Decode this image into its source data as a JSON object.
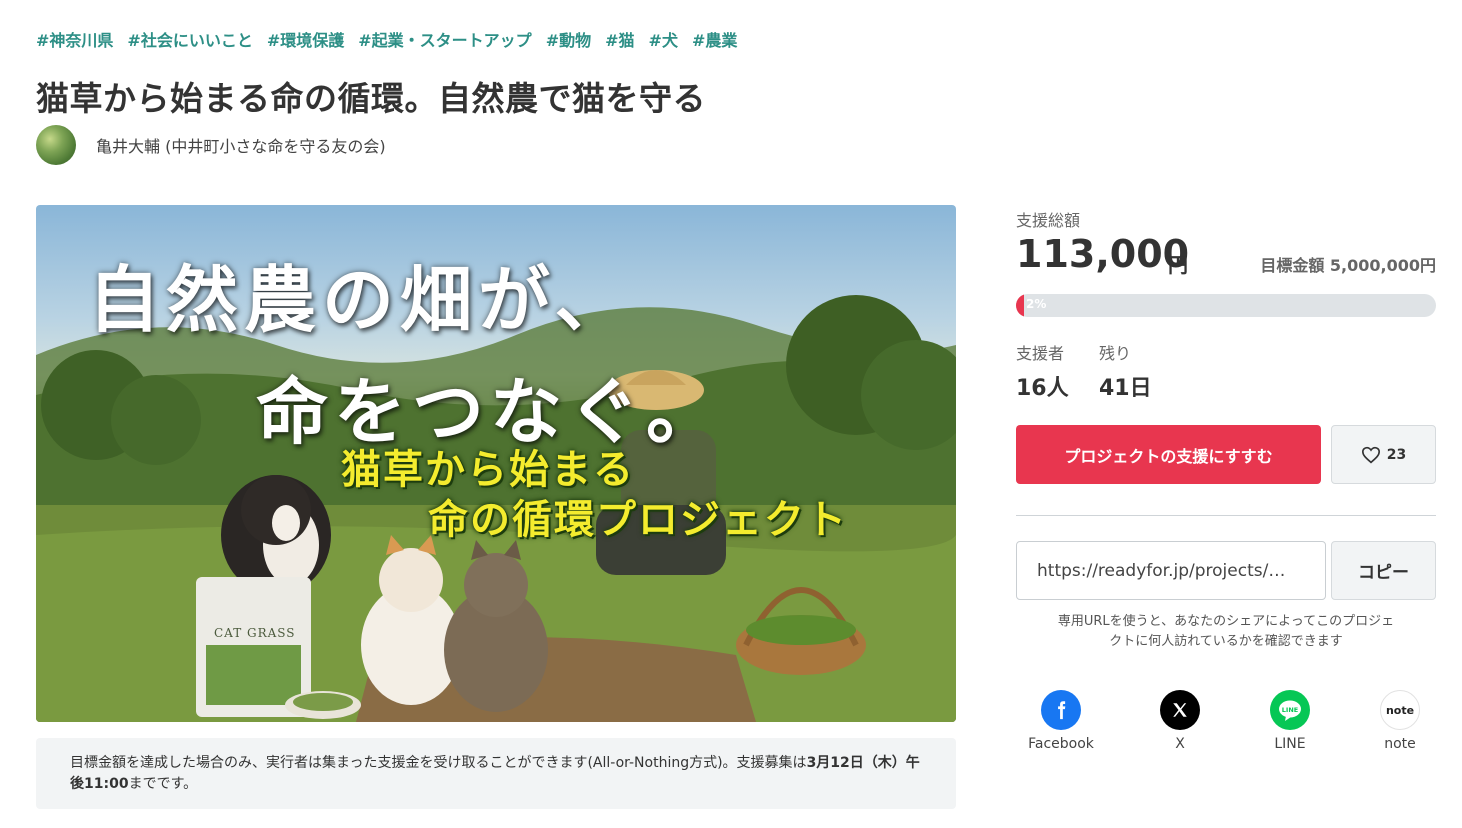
{
  "tags": [
    "#神奈川県",
    "#社会にいいこと",
    "#環境保護",
    "#起業・スタートアップ",
    "#動物",
    "#猫",
    "#犬",
    "#農業"
  ],
  "project": {
    "title": "猫草から始まる命の循環。自然農で猫を守る",
    "owner": "亀井大輔 (中井町小さな命を守る友の会)"
  },
  "hero": {
    "line1": "自然農の畑が、",
    "line2": "命をつなぐ。",
    "sub1": "猫草から始まる",
    "sub2": "命の循環プロジェクト",
    "bag_label": "CAT GRASS"
  },
  "notice": {
    "text1": "目標金額を達成した場合のみ、実行者は集まった支援金を受け取ることができます(All-or-Nothing方式)。支援募集は",
    "deadline": "3月12日（木）午後11:00",
    "text2": "までです。"
  },
  "funding": {
    "total_label": "支援総額",
    "total": "113,000",
    "unit": "円",
    "goal_label": "目標金額 5,000,000円",
    "progress_pct": 2,
    "progress_label": "2%",
    "supporters_label": "支援者",
    "supporters": "16人",
    "remaining_label": "残り",
    "remaining": "41日"
  },
  "actions": {
    "support_label": "プロジェクトの支援にすすむ",
    "favorites": "23"
  },
  "share_url": {
    "value": "https://readyfor.jp/projects/…",
    "copy_label": "コピー",
    "help": "専用URLを使うと、あなたのシェアによってこのプロジェクトに何人訪れているかを確認できます"
  },
  "share": [
    {
      "name": "Facebook",
      "icon": "facebook-icon"
    },
    {
      "name": "X",
      "icon": "x-icon"
    },
    {
      "name": "LINE",
      "icon": "line-icon"
    },
    {
      "name": "note",
      "icon": "note-icon"
    }
  ],
  "colors": {
    "accent": "#e8364f",
    "tag": "#2d8f86"
  }
}
